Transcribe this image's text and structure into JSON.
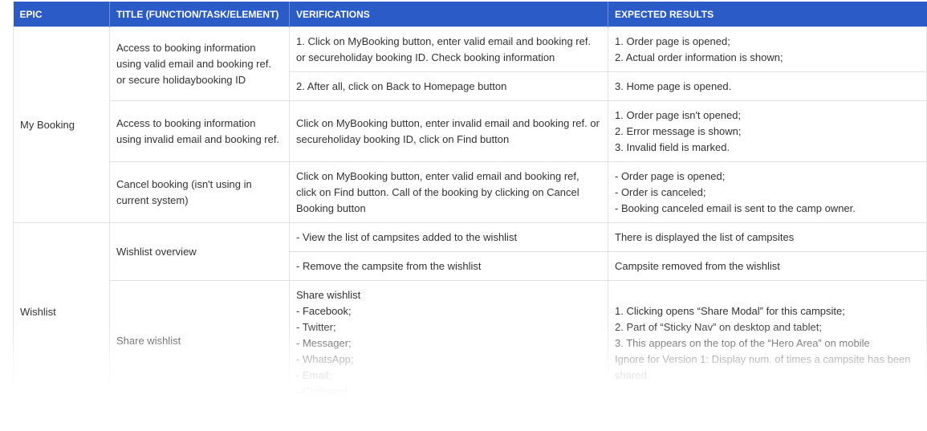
{
  "headers": [
    "EPIC",
    "TITLE (FUNCTION/TASK/ELEMENT)",
    "VERIFICATIONS",
    "EXPECTED RESULTS"
  ],
  "epics": {
    "my_booking": "My Booking",
    "wishlist": "Wishlist"
  },
  "rows": {
    "r1": {
      "title": "Access to booking information using valid email and booking ref. or secure holidaybooking ID",
      "v1": "1. Click on MyBooking button, enter valid email and booking ref. or secureholiday booking ID. Check booking information",
      "e1": [
        "1. Order page is opened;",
        "2. Actual order information is shown;"
      ],
      "v2": "2. After all, click on Back to Homepage button",
      "e2": "3. Home page is opened."
    },
    "r2": {
      "title": "Access to booking information using invalid email and booking ref.",
      "v": "Click on MyBooking button, enter invalid email and booking ref. or secureholiday booking ID, click on Find button",
      "e": [
        "1. Order page isn't opened;",
        "2. Error message is shown;",
        "3. Invalid field is marked."
      ]
    },
    "r3": {
      "title": "Cancel booking (isn't using in current system)",
      "v": "Click on MyBooking button, enter valid email and booking ref, click on Find button. Call of the booking by clicking on Cancel Booking button",
      "e": [
        "- Order page is opened;",
        "- Order is canceled;",
        "- Booking canceled email is sent to the camp owner."
      ]
    },
    "r4": {
      "title": "Wishlist overview",
      "v1": "- View the list of campsites added to the wishlist",
      "e1": "There is displayed the list of campsites",
      "v2": "- Remove the campsite from the wishlist",
      "e2": "Campsite removed from the wishlist"
    },
    "r5": {
      "title": "Share wishlist",
      "v": [
        "Share wishlist",
        "- Facebook;",
        "- Twitter;",
        "- Messager;",
        "- WhatsApp;",
        "- Email;",
        "- Clipboard."
      ],
      "e": [
        "1. Clicking opens “Share Modal” for this campsite;",
        "2. Part of “Sticky Nav” on desktop and tablet;",
        "3. This appears on the top of the “Hero Area” on mobile",
        "Ignore for Version 1: Display num. of times a campsite has been shared."
      ]
    }
  },
  "colors": {
    "header_bg": "#2a5bc7"
  }
}
